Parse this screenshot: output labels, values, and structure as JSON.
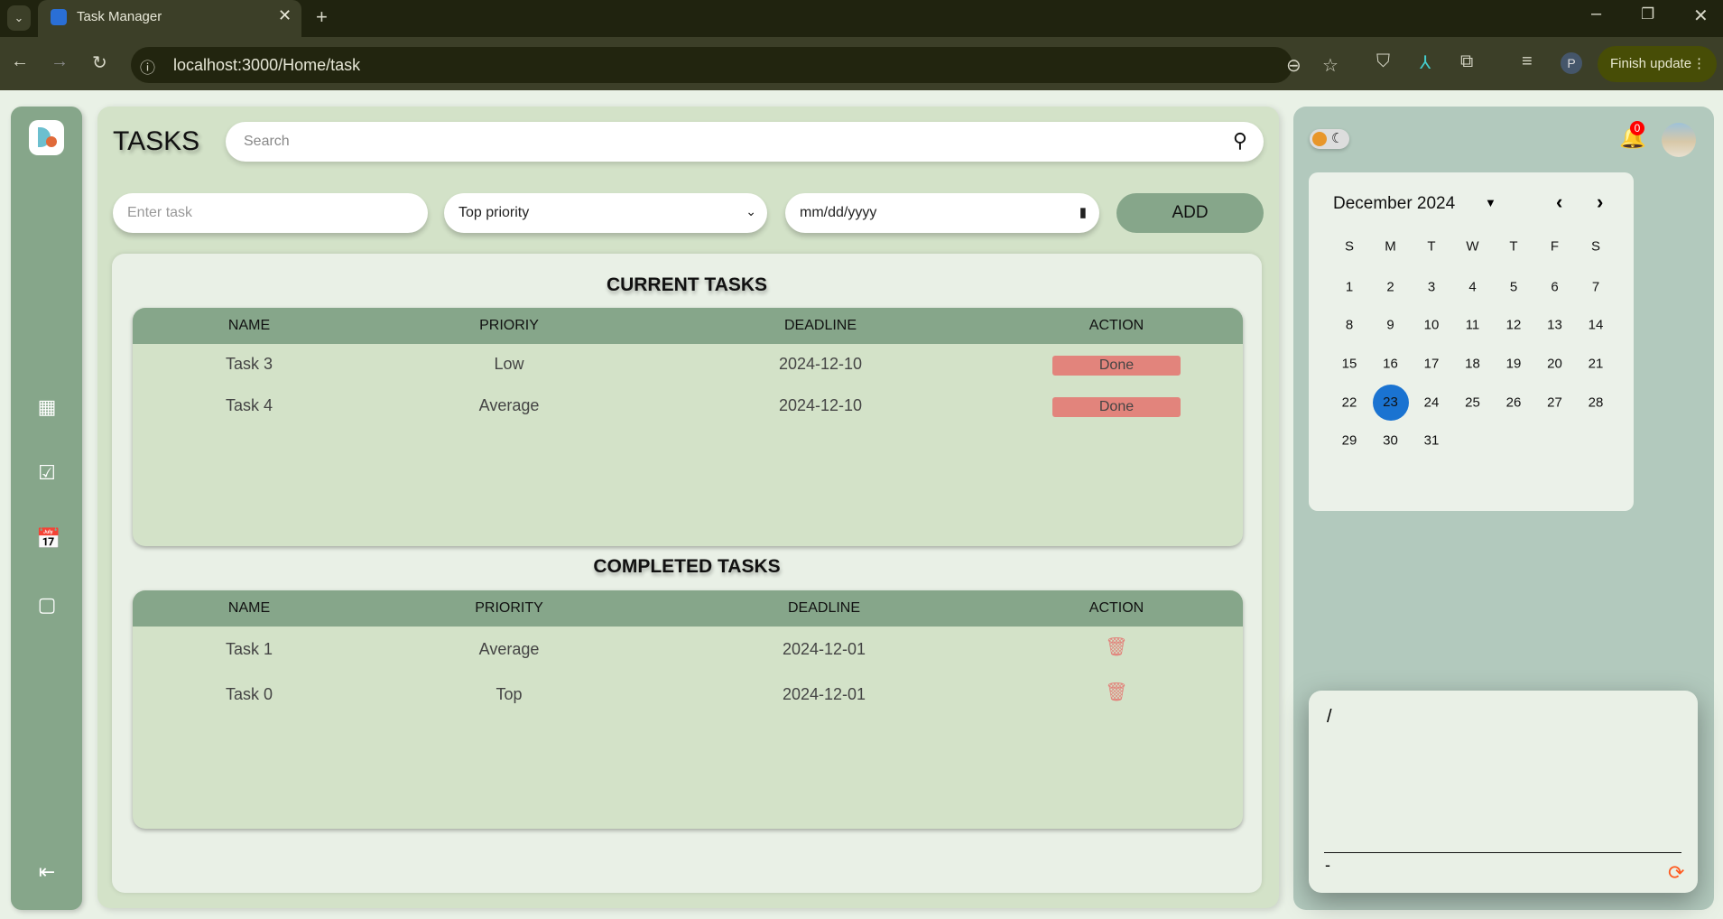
{
  "browser": {
    "tab_title": "Task Manager",
    "url": "localhost:3000/Home/task",
    "finish_update": "Finish update",
    "profile_initial": "P"
  },
  "header": {
    "title": "TASKS",
    "search_placeholder": "Search"
  },
  "form": {
    "task_placeholder": "Enter task",
    "priority_selected": "Top priority",
    "date_placeholder": "mm/dd/yyyy",
    "add_label": "ADD"
  },
  "current": {
    "title": "CURRENT TASKS",
    "headers": [
      "NAME",
      "PRIORIY",
      "DEADLINE",
      "ACTION"
    ],
    "rows": [
      {
        "name": "Task 3",
        "priority": "Low",
        "deadline": "2024-12-10",
        "action": "Done"
      },
      {
        "name": "Task 4",
        "priority": "Average",
        "deadline": "2024-12-10",
        "action": "Done"
      }
    ]
  },
  "completed": {
    "title": "COMPLETED TASKS",
    "headers": [
      "NAME",
      "PRIORITY",
      "DEADLINE",
      "ACTION"
    ],
    "rows": [
      {
        "name": "Task 1",
        "priority": "Average",
        "deadline": "2024-12-01"
      },
      {
        "name": "Task 0",
        "priority": "Top",
        "deadline": "2024-12-01"
      }
    ]
  },
  "notifications": {
    "count": "0"
  },
  "calendar": {
    "month_label": "December 2024",
    "weekdays": [
      "S",
      "M",
      "T",
      "W",
      "T",
      "F",
      "S"
    ],
    "weeks": [
      [
        "1",
        "2",
        "3",
        "4",
        "5",
        "6",
        "7"
      ],
      [
        "8",
        "9",
        "10",
        "11",
        "12",
        "13",
        "14"
      ],
      [
        "15",
        "16",
        "17",
        "18",
        "19",
        "20",
        "21"
      ],
      [
        "22",
        "23",
        "24",
        "25",
        "26",
        "27",
        "28"
      ],
      [
        "29",
        "30",
        "31",
        "",
        "",
        "",
        ""
      ]
    ],
    "selected": "23",
    "selected_color": "#1a73d1"
  },
  "note": {
    "text": "/",
    "footer": "-"
  },
  "colors": {
    "sidebar": "#86a68a",
    "panel": "#d3e2c8",
    "right_panel": "#b2c9bd",
    "done_button": "#e2847c",
    "delete_icon": "#e2847c",
    "refresh_icon": "#ff5a1f"
  }
}
